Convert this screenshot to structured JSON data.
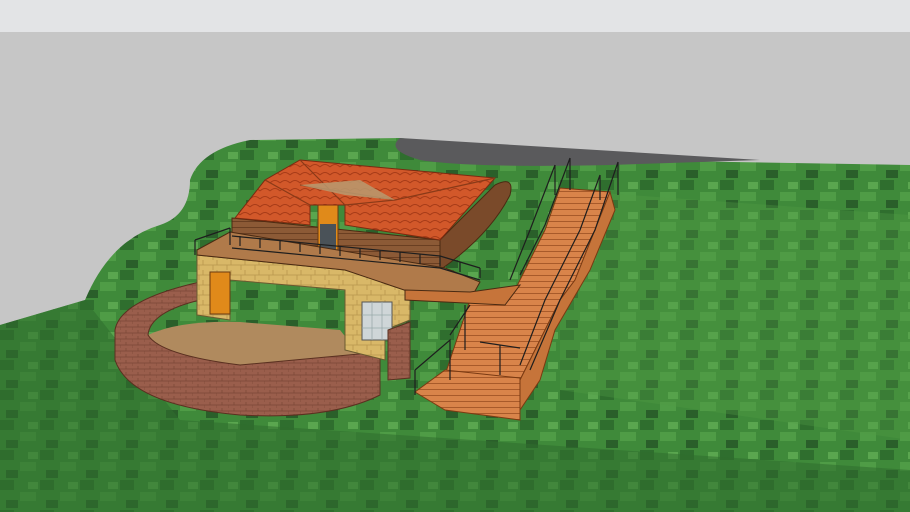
{
  "scene": {
    "type": "3d-model-viewport",
    "colors": {
      "sky": "#e3e4e6",
      "ground_plane": "#c6c6c6",
      "terrain_green": "#3f8a3a",
      "terrain_dark": "#245c25",
      "road": "#5a5a5c",
      "roof_tile": "#d2582a",
      "wood_wall": "#8c5a36",
      "stone_wall": "#d9b868",
      "brick_wall": "#9a5e4c",
      "stair_brick": "#d9844a",
      "door_orange": "#e08a1a",
      "railing": "#222222"
    },
    "objects": [
      "terrain",
      "road",
      "house",
      "roof",
      "upper-deck",
      "stone-wall",
      "curved-brick-wall",
      "patio",
      "staircase",
      "railings",
      "window",
      "door"
    ]
  }
}
